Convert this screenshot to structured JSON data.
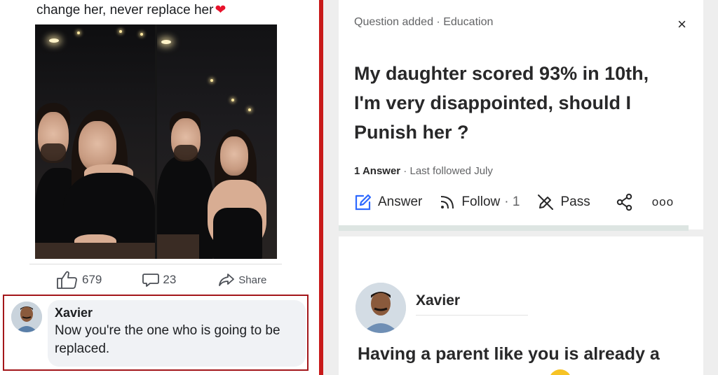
{
  "left_post": {
    "caption": "change her, never replace her",
    "caption_emoji": "red-heart",
    "like_count": "679",
    "comment_count": "23",
    "share_label": "Share",
    "comment": {
      "author": "Xavier",
      "text_line1": "Now you're the one who is going to be",
      "text_line2": "replaced."
    }
  },
  "right_question": {
    "meta": "Question added · Education",
    "close_icon": "×",
    "title_line1": "My daughter scored 93% in 10th,",
    "title_line2": "I'm very disappointed, should  I",
    "title_line3": "Punish  her ?",
    "answers_count": "1 Answer",
    "followed_text": " · Last followed July",
    "actions": {
      "answer_label": "Answer",
      "follow_label": "Follow",
      "follow_count": "· 1",
      "pass_label": "Pass",
      "more_label": "ooo"
    },
    "answer": {
      "author": "Xavier",
      "text": "Having a parent like you is already a"
    }
  },
  "colors": {
    "divider_red": "#c81a1a",
    "comment_border": "#a3161a",
    "answer_icon": "#1c3a6e"
  }
}
